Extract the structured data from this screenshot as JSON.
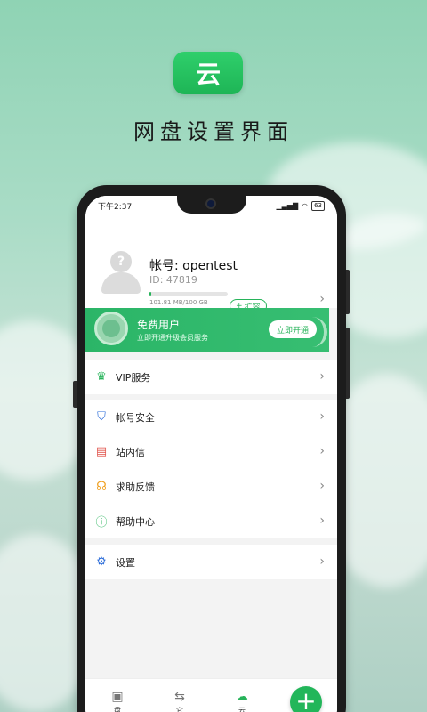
{
  "hero": {
    "logo_text": "云",
    "title": "网盘设置界面"
  },
  "status": {
    "time": "下午2:37",
    "signal": "▁▃▅▇",
    "wifi": "◠",
    "battery": "63"
  },
  "profile": {
    "account": "帐号: opentest",
    "id": "ID: 47819",
    "storage": "101.81 MB/100 GB",
    "storage_fill": 0.001,
    "expand_label": "扩容",
    "avatar_mark": "?"
  },
  "vip": {
    "title": "免费用户",
    "subtitle": "立即开通升级会员服务",
    "button": "立即开通"
  },
  "menu": {
    "vip": {
      "label": "VIP服务"
    },
    "security": {
      "label": "帐号安全"
    },
    "messages": {
      "label": "站内信"
    },
    "feedback": {
      "label": "求助反馈"
    },
    "help": {
      "label": "帮助中心"
    },
    "settings": {
      "label": "设置"
    }
  },
  "tabs": [
    {
      "label": "盘",
      "icon": "disk-icon"
    },
    {
      "label": "它",
      "icon": "transfer-icon"
    },
    {
      "label": "云",
      "icon": "cloud-icon"
    }
  ],
  "fab": {
    "icon": "+"
  },
  "colors": {
    "accent": "#27b35a",
    "vip_bg": "#2bb567"
  }
}
